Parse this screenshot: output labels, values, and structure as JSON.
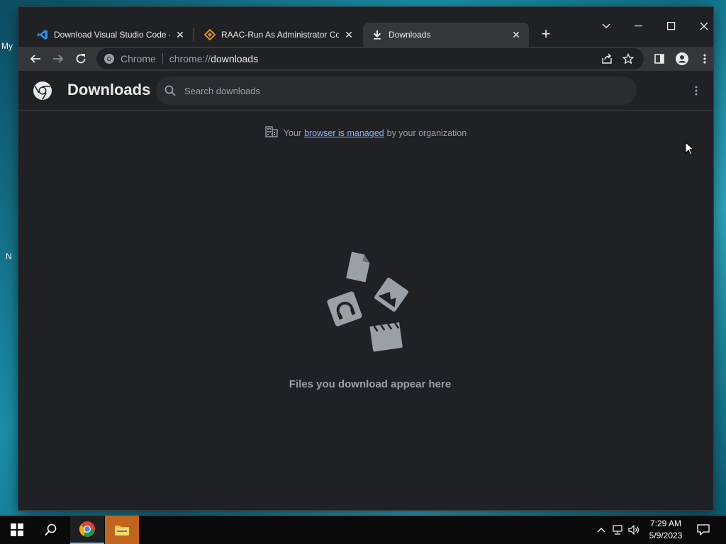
{
  "desktop": {
    "fragments": [
      "My",
      "N"
    ]
  },
  "tabs": [
    {
      "title": "Download Visual Studio Code - M",
      "icon": "vscode-icon",
      "active": false
    },
    {
      "title": "RAAC-Run As Administrator Con",
      "icon": "raac-icon",
      "active": false
    },
    {
      "title": "Downloads",
      "icon": "download-icon",
      "active": true
    }
  ],
  "toolbar": {
    "site_label": "Chrome",
    "url_scheme": "chrome://",
    "url_host": "downloads"
  },
  "downloads": {
    "title": "Downloads",
    "search_placeholder": "Search downloads",
    "managed_prefix": "Your",
    "managed_link": "browser is managed",
    "managed_suffix": "by your organization",
    "empty_message": "Files you download appear here"
  },
  "taskbar": {
    "time": "7:29 AM",
    "date": "5/9/2023"
  },
  "colors": {
    "window_bg": "#202124",
    "toolbar_bg": "#35363a",
    "link": "#8ab4f8",
    "text_secondary": "#9aa0a6",
    "art_gray": "#9aa0a6"
  }
}
